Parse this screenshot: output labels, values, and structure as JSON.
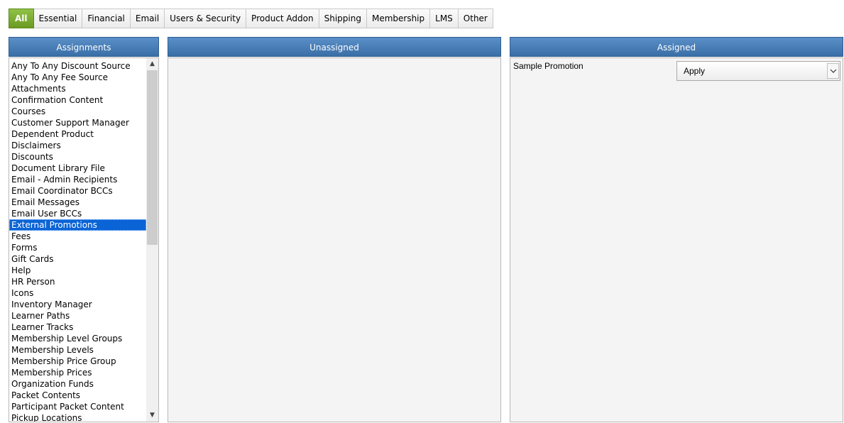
{
  "tabs": [
    {
      "label": "All",
      "active": true
    },
    {
      "label": "Essential"
    },
    {
      "label": "Financial"
    },
    {
      "label": "Email"
    },
    {
      "label": "Users & Security"
    },
    {
      "label": "Product Addon"
    },
    {
      "label": "Shipping"
    },
    {
      "label": "Membership"
    },
    {
      "label": "LMS"
    },
    {
      "label": "Other"
    }
  ],
  "assignments": {
    "title": "Assignments",
    "selected": "External Promotions",
    "items": [
      "Any To Any Discount Source",
      "Any To Any Fee Source",
      "Attachments",
      "Confirmation Content",
      "Courses",
      "Customer Support Manager",
      "Dependent Product",
      "Disclaimers",
      "Discounts",
      "Document Library File",
      "Email - Admin Recipients",
      "Email Coordinator BCCs",
      "Email Messages",
      "Email User BCCs",
      "External Promotions",
      "Fees",
      "Forms",
      "Gift Cards",
      "Help",
      "HR Person",
      "Icons",
      "Inventory Manager",
      "Learner Paths",
      "Learner Tracks",
      "Membership Level Groups",
      "Membership Levels",
      "Membership Price Group",
      "Membership Prices",
      "Organization Funds",
      "Packet Contents",
      "Participant Packet Content",
      "Pickup Locations"
    ]
  },
  "unassigned": {
    "title": "Unassigned"
  },
  "assigned": {
    "title": "Assigned",
    "rows": [
      {
        "label": "Sample Promotion",
        "value": "Apply"
      }
    ]
  },
  "colors": {
    "active_tab": "#7aad2f",
    "panel_header": "#4a7fb8",
    "selection": "#0a64d6"
  }
}
